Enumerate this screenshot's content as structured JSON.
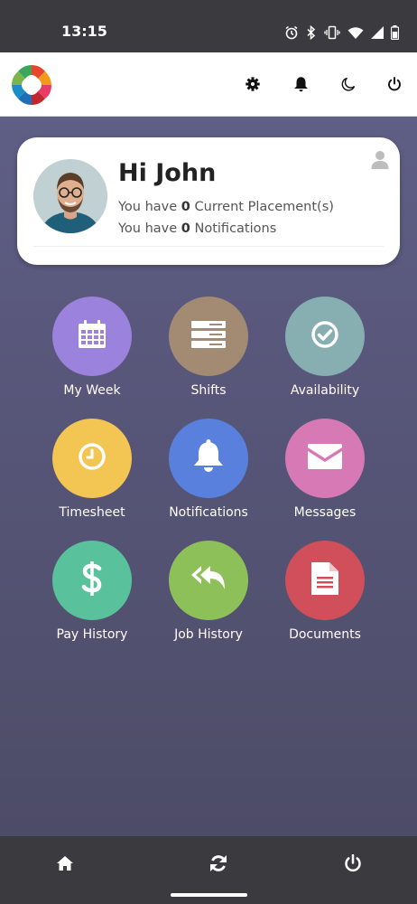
{
  "status_bar": {
    "time": "13:15",
    "icons": [
      "alarm-icon",
      "bluetooth-icon",
      "vibrate-icon",
      "wifi-icon",
      "signal-icon",
      "battery-icon"
    ]
  },
  "header": {
    "logo": "app-logo",
    "actions": [
      "settings-gear-icon",
      "notification-bell-icon",
      "dark-mode-moon-icon",
      "power-icon"
    ]
  },
  "profile": {
    "greeting": "Hi John",
    "line1_prefix": "You have ",
    "placements_count": "0",
    "line1_suffix": " Current Placement(s)",
    "line2_prefix": "You have ",
    "notifications_count": "0",
    "line2_suffix": " Notifications"
  },
  "tiles": [
    {
      "label": "My Week",
      "color": "#9b82dc",
      "icon": "calendar-icon"
    },
    {
      "label": "Shifts",
      "color": "#a38a73",
      "icon": "shifts-list-icon"
    },
    {
      "label": "Availability",
      "color": "#87aeb0",
      "icon": "check-circle-icon"
    },
    {
      "label": "Timesheet",
      "color": "#f3c552",
      "icon": "clock-icon"
    },
    {
      "label": "Notifications",
      "color": "#5880dc",
      "icon": "bell-icon"
    },
    {
      "label": "Messages",
      "color": "#d679b5",
      "icon": "envelope-icon"
    },
    {
      "label": "Pay History",
      "color": "#59c19b",
      "icon": "dollar-icon"
    },
    {
      "label": "Job History",
      "color": "#8ec059",
      "icon": "reply-all-icon"
    },
    {
      "label": "Documents",
      "color": "#d04f5a",
      "icon": "document-icon"
    }
  ],
  "bottom_nav": {
    "items": [
      "home-icon",
      "refresh-icon",
      "power-icon"
    ]
  }
}
